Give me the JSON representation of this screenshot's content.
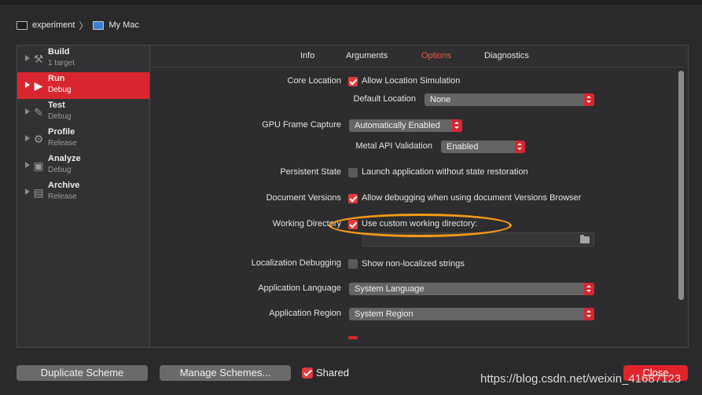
{
  "breadcrumb": {
    "scheme": "experiment",
    "destination": "My Mac"
  },
  "sidebar": {
    "items": [
      {
        "title": "Build",
        "subtitle": "1 target",
        "icon": "hammer-icon",
        "active": false
      },
      {
        "title": "Run",
        "subtitle": "Debug",
        "icon": "play-icon",
        "active": true
      },
      {
        "title": "Test",
        "subtitle": "Debug",
        "icon": "wrench-icon",
        "active": false
      },
      {
        "title": "Profile",
        "subtitle": "Release",
        "icon": "gauge-icon",
        "active": false
      },
      {
        "title": "Analyze",
        "subtitle": "Debug",
        "icon": "lock-icon",
        "active": false
      },
      {
        "title": "Archive",
        "subtitle": "Release",
        "icon": "archive-icon",
        "active": false
      }
    ]
  },
  "tabs": {
    "info": "Info",
    "arguments": "Arguments",
    "options": "Options",
    "diagnostics": "Diagnostics",
    "active": "Options"
  },
  "options": {
    "core_location": {
      "label": "Core Location",
      "checkbox_label": "Allow Location Simulation",
      "checked": true,
      "default_location_label": "Default Location",
      "default_location_value": "None"
    },
    "gpu_frame_capture": {
      "label": "GPU Frame Capture",
      "value": "Automatically Enabled",
      "metal_label": "Metal API Validation",
      "metal_value": "Enabled"
    },
    "persistent_state": {
      "label": "Persistent State",
      "checkbox_label": "Launch application without state restoration",
      "checked": false
    },
    "document_versions": {
      "label": "Document Versions",
      "checkbox_label": "Allow debugging when using document Versions Browser",
      "checked": true
    },
    "working_directory": {
      "label": "Working Directory",
      "checkbox_label": "Use custom working directory:",
      "checked": true,
      "path": ""
    },
    "localization_debugging": {
      "label": "Localization Debugging",
      "checkbox_label": "Show non-localized strings",
      "checked": false
    },
    "application_language": {
      "label": "Application Language",
      "value": "System Language"
    },
    "application_region": {
      "label": "Application Region",
      "value": "System Region"
    }
  },
  "footer": {
    "duplicate": "Duplicate Scheme",
    "manage": "Manage Schemes...",
    "shared_label": "Shared",
    "shared_checked": true,
    "close": "Close"
  },
  "watermark": "https://blog.csdn.net/weixin_41687123",
  "colors": {
    "accent": "#d9262e",
    "highlight": "#f39a18",
    "background": "#2a2a2c"
  }
}
